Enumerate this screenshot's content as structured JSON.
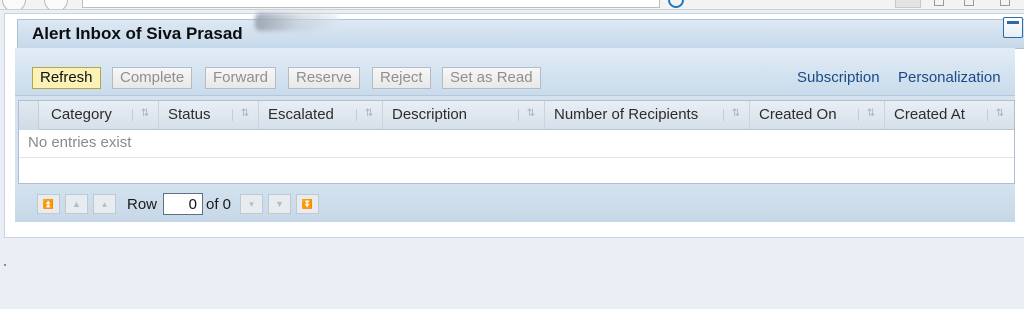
{
  "title": "Alert Inbox of Siva Prasad",
  "toolbar": {
    "buttons": [
      {
        "label": "Refresh",
        "state": "active"
      },
      {
        "label": "Complete",
        "state": "disabled"
      },
      {
        "label": "Forward",
        "state": "disabled"
      },
      {
        "label": "Reserve",
        "state": "disabled"
      },
      {
        "label": "Reject",
        "state": "disabled"
      },
      {
        "label": "Set as Read",
        "state": "disabled"
      }
    ],
    "links": [
      "Subscription",
      "Personalization"
    ]
  },
  "table": {
    "columns": [
      "Category",
      "Status",
      "Escalated",
      "Description",
      "Number of Recipients",
      "Created On",
      "Created At"
    ],
    "empty_message": "No entries exist"
  },
  "pager": {
    "row_label": "Row",
    "current_row": "0",
    "of_text": "of 0"
  },
  "colors": {
    "accent": "#1b4a89",
    "active_button": "#fbf3b6",
    "toolbar_blue": "#c9dbeb"
  }
}
